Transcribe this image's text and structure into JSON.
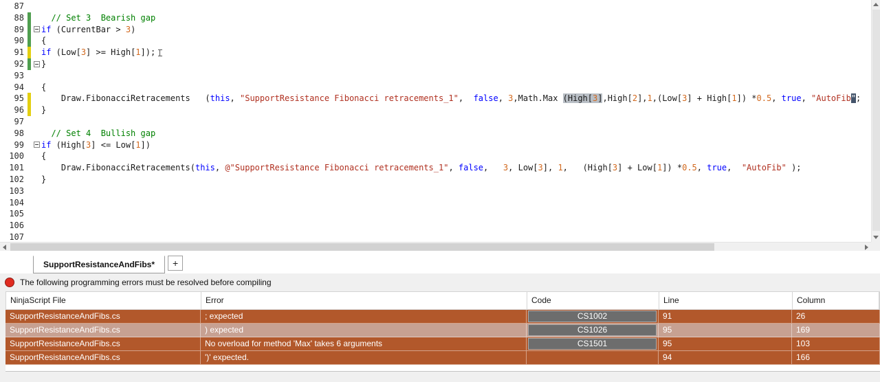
{
  "tabs": {
    "active": "SupportResistanceAndFibs*",
    "add": "+"
  },
  "status": {
    "message": "The following programming errors must be resolved before compiling"
  },
  "errors": {
    "columns": [
      "NinjaScript File",
      "Error",
      "Code",
      "Line",
      "Column"
    ],
    "rows": [
      {
        "file": "SupportResistanceAndFibs.cs",
        "error": "; expected",
        "code": "CS1002",
        "line": "91",
        "column": "26",
        "selected": false
      },
      {
        "file": "SupportResistanceAndFibs.cs",
        "error": ") expected",
        "code": "CS1026",
        "line": "95",
        "column": "169",
        "selected": true
      },
      {
        "file": "SupportResistanceAndFibs.cs",
        "error": "No overload for method 'Max' takes 6 arguments",
        "code": "CS1501",
        "line": "95",
        "column": "103",
        "selected": false
      },
      {
        "file": "SupportResistanceAndFibs.cs",
        "error": "')' expected.",
        "code": "",
        "line": "94",
        "column": "166",
        "selected": false
      }
    ]
  },
  "editor": {
    "colors": {
      "keyword": "#0000ff",
      "comment": "#008000",
      "string": "#b03020",
      "number": "#d2691e",
      "change_bar_green": "#4f9e4f",
      "change_bar_yellow": "#e3cf10",
      "error_row": "#b2582b",
      "selected_row": "#c7a192"
    },
    "lines": [
      {
        "num": "87",
        "bar": "",
        "fold": false,
        "seg": []
      },
      {
        "num": "88",
        "bar": "g",
        "fold": false,
        "seg": [
          {
            "t": "  ",
            "c": "p"
          },
          {
            "t": "// Set 3  Bearish gap",
            "c": "c"
          }
        ]
      },
      {
        "num": "89",
        "bar": "g",
        "fold": true,
        "seg": [
          {
            "t": "if",
            "c": "k"
          },
          {
            "t": " (CurrentBar > ",
            "c": "p"
          },
          {
            "t": "3",
            "c": "n"
          },
          {
            "t": ")",
            "c": "p"
          }
        ]
      },
      {
        "num": "90",
        "bar": "g",
        "fold": false,
        "seg": [
          {
            "t": "{",
            "c": "p"
          }
        ]
      },
      {
        "num": "91",
        "bar": "y",
        "fold": false,
        "seg": [
          {
            "t": "if",
            "c": "k"
          },
          {
            "t": " (Low[",
            "c": "p"
          },
          {
            "t": "3",
            "c": "n"
          },
          {
            "t": "] >= High[",
            "c": "p"
          },
          {
            "t": "1",
            "c": "n"
          },
          {
            "t": "]);",
            "c": "p"
          },
          {
            "t": "",
            "c": "caret"
          }
        ]
      },
      {
        "num": "92",
        "bar": "g",
        "fold": true,
        "seg": [
          {
            "t": "}",
            "c": "p"
          }
        ]
      },
      {
        "num": "93",
        "bar": "",
        "fold": false,
        "seg": []
      },
      {
        "num": "94",
        "bar": "",
        "fold": false,
        "seg": [
          {
            "t": "{",
            "c": "p"
          }
        ]
      },
      {
        "num": "95",
        "bar": "y",
        "fold": false,
        "seg": [
          {
            "t": "    Draw.FibonacciRetracements   (",
            "c": "p"
          },
          {
            "t": "this",
            "c": "k"
          },
          {
            "t": ", ",
            "c": "p"
          },
          {
            "t": "\"SupportResistance Fibonacci retracements_1\"",
            "c": "s"
          },
          {
            "t": ",  ",
            "c": "p"
          },
          {
            "t": "false",
            "c": "k"
          },
          {
            "t": ", ",
            "c": "p"
          },
          {
            "t": "3",
            "c": "n"
          },
          {
            "t": ",Math.Max ",
            "c": "p"
          },
          {
            "t": "(High[",
            "c": "p sel"
          },
          {
            "t": "3",
            "c": "n sel"
          },
          {
            "t": "]",
            "c": "p sel"
          },
          {
            "t": ",High[",
            "c": "p"
          },
          {
            "t": "2",
            "c": "n"
          },
          {
            "t": "],",
            "c": "p"
          },
          {
            "t": "1",
            "c": "n"
          },
          {
            "t": ",(Low[",
            "c": "p"
          },
          {
            "t": "3",
            "c": "n"
          },
          {
            "t": "] + High[",
            "c": "p"
          },
          {
            "t": "1",
            "c": "n"
          },
          {
            "t": "]) *",
            "c": "p"
          },
          {
            "t": "0.5",
            "c": "n"
          },
          {
            "t": ", ",
            "c": "p"
          },
          {
            "t": "true",
            "c": "k"
          },
          {
            "t": ", ",
            "c": "p"
          },
          {
            "t": "\"AutoFib",
            "c": "s"
          },
          {
            "t": "\"",
            "c": "s hl"
          },
          {
            "t": ";",
            "c": "p"
          }
        ]
      },
      {
        "num": "96",
        "bar": "y",
        "fold": false,
        "seg": [
          {
            "t": "}",
            "c": "p"
          }
        ]
      },
      {
        "num": "97",
        "bar": "",
        "fold": false,
        "seg": []
      },
      {
        "num": "98",
        "bar": "",
        "fold": false,
        "seg": [
          {
            "t": "  ",
            "c": "p"
          },
          {
            "t": "// Set 4  Bullish gap",
            "c": "c"
          }
        ]
      },
      {
        "num": "99",
        "bar": "",
        "fold": true,
        "seg": [
          {
            "t": "if",
            "c": "k"
          },
          {
            "t": " (High[",
            "c": "p"
          },
          {
            "t": "3",
            "c": "n"
          },
          {
            "t": "] <= Low[",
            "c": "p"
          },
          {
            "t": "1",
            "c": "n"
          },
          {
            "t": "])",
            "c": "p"
          }
        ]
      },
      {
        "num": "100",
        "bar": "",
        "fold": false,
        "seg": [
          {
            "t": "{",
            "c": "p"
          }
        ]
      },
      {
        "num": "101",
        "bar": "",
        "fold": false,
        "seg": [
          {
            "t": "    Draw.FibonacciRetracements(",
            "c": "p"
          },
          {
            "t": "this",
            "c": "k"
          },
          {
            "t": ", ",
            "c": "p"
          },
          {
            "t": "@\"SupportResistance Fibonacci retracements_1\"",
            "c": "s"
          },
          {
            "t": ", ",
            "c": "p"
          },
          {
            "t": "false",
            "c": "k"
          },
          {
            "t": ",   ",
            "c": "p"
          },
          {
            "t": "3",
            "c": "n"
          },
          {
            "t": ", Low[",
            "c": "p"
          },
          {
            "t": "3",
            "c": "n"
          },
          {
            "t": "], ",
            "c": "p"
          },
          {
            "t": "1",
            "c": "n"
          },
          {
            "t": ",   (High[",
            "c": "p"
          },
          {
            "t": "3",
            "c": "n"
          },
          {
            "t": "] + Low[",
            "c": "p"
          },
          {
            "t": "1",
            "c": "n"
          },
          {
            "t": "]) *",
            "c": "p"
          },
          {
            "t": "0.5",
            "c": "n"
          },
          {
            "t": ", ",
            "c": "p"
          },
          {
            "t": "true",
            "c": "k"
          },
          {
            "t": ",  ",
            "c": "p"
          },
          {
            "t": "\"AutoFib\"",
            "c": "s"
          },
          {
            "t": " );",
            "c": "p"
          }
        ]
      },
      {
        "num": "102",
        "bar": "",
        "fold": false,
        "seg": [
          {
            "t": "}",
            "c": "p"
          }
        ]
      },
      {
        "num": "103",
        "bar": "",
        "fold": false,
        "seg": []
      },
      {
        "num": "104",
        "bar": "",
        "fold": false,
        "seg": []
      },
      {
        "num": "105",
        "bar": "",
        "fold": false,
        "seg": []
      },
      {
        "num": "106",
        "bar": "",
        "fold": false,
        "seg": []
      },
      {
        "num": "107",
        "bar": "",
        "fold": false,
        "seg": []
      }
    ]
  }
}
